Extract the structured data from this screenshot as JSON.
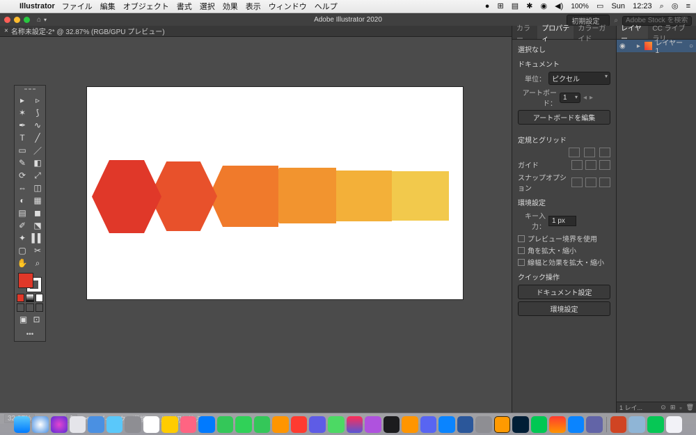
{
  "menubar": {
    "app": "Illustrator",
    "items": [
      "ファイル",
      "編集",
      "オブジェクト",
      "書式",
      "選択",
      "効果",
      "表示",
      "ウィンドウ",
      "ヘルプ"
    ],
    "battery": "100%",
    "day": "Sun",
    "time": "12:23"
  },
  "appbar": {
    "title": "Adobe Illustrator 2020",
    "workspace": "初期設定",
    "search_placeholder": "Adobe Stock を検索"
  },
  "tab": {
    "label": "名称未設定-2* @ 32.87% (RGB/GPU プレビュー)"
  },
  "props": {
    "tabs": [
      "カラー",
      "プロパティ",
      "カラーガイド"
    ],
    "no_selection": "選択なし",
    "doc_title": "ドキュメント",
    "unit_label": "単位：",
    "unit_value": "ピクセル",
    "artboard_label": "アートボード：",
    "artboard_value": "1",
    "edit_artboard": "アートボードを編集",
    "ruler_grid": "定規とグリッド",
    "guide": "ガイド",
    "snap": "スナップオプション",
    "prefs": "環境設定",
    "key_label": "キー入力：",
    "key_value": "1 px",
    "chk1": "プレビュー境界を使用",
    "chk2": "角を拡大・縮小",
    "chk3": "線幅と効果を拡大・縮小",
    "quick": "クイック操作",
    "docset": "ドキュメント設定",
    "envset": "環境設定"
  },
  "layers": {
    "tabs": [
      "レイヤー",
      "CC ライブラリ"
    ],
    "layer1": "レイヤー 1",
    "footer": "1 レイ..."
  },
  "status": {
    "zoom": "32.87%",
    "artboard": "1",
    "hint": "ダイレクト選択ツールを切り換え"
  },
  "colors": {
    "hex1": "#e03829",
    "hex2": "#e8512b",
    "hex3": "#f07a2b",
    "hex4": "#f2942f",
    "hex5": "#f3b039",
    "hex6": "#f2c94c"
  }
}
